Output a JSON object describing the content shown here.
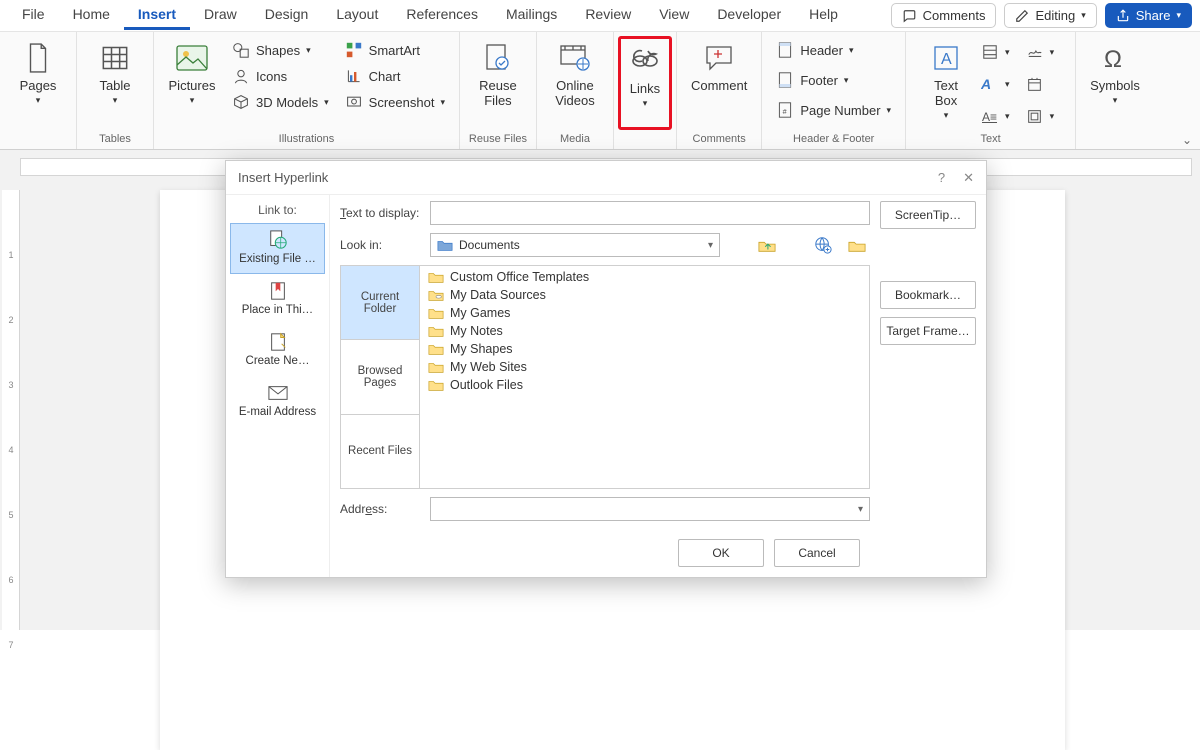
{
  "tabs": [
    "File",
    "Home",
    "Insert",
    "Draw",
    "Design",
    "Layout",
    "References",
    "Mailings",
    "Review",
    "View",
    "Developer",
    "Help"
  ],
  "active_tab_index": 2,
  "top_right": {
    "comments": "Comments",
    "editing": "Editing",
    "share": "Share"
  },
  "groups": {
    "pages": {
      "btn": "Pages",
      "label": ""
    },
    "tables": {
      "btn": "Table",
      "label": "Tables"
    },
    "illustrations": {
      "pictures": "Pictures",
      "small": [
        "Shapes",
        "Icons",
        "3D Models",
        "SmartArt",
        "Chart",
        "Screenshot"
      ],
      "label": "Illustrations"
    },
    "reuse": {
      "btn": "Reuse\nFiles",
      "label": "Reuse Files"
    },
    "media": {
      "btn": "Online\nVideos",
      "label": "Media"
    },
    "links": {
      "btn": "Links"
    },
    "comments": {
      "btn": "Comment",
      "label": "Comments"
    },
    "headerfooter": {
      "items": [
        "Header",
        "Footer",
        "Page Number"
      ],
      "label": "Header & Footer"
    },
    "text": {
      "btn": "Text\nBox",
      "label": "Text"
    },
    "symbols": {
      "btn": "Symbols"
    }
  },
  "dialog": {
    "title": "Insert Hyperlink",
    "linkto_label": "Link to:",
    "linkto": [
      "Existing File …",
      "Place in Thi…",
      "Create Ne…",
      "E-mail Address"
    ],
    "text_to_display": "Text to display:",
    "text_to_display_underline": "T",
    "screentip": "ScreenTip…",
    "lookin_label": "Look in:",
    "lookin_value": "Documents",
    "browse_tabs": [
      "Current Folder",
      "Browsed Pages",
      "Recent Files"
    ],
    "files": [
      "Custom Office Templates",
      "My Data Sources",
      "My Games",
      "My Notes",
      "My Shapes",
      "My Web Sites",
      "Outlook Files"
    ],
    "bookmark": "Bookmark…",
    "target_frame": "Target Frame…",
    "address_label": "Address:",
    "address_underline": "e",
    "ok": "OK",
    "cancel": "Cancel"
  },
  "ruler_ticks": [
    "",
    "",
    "1",
    "",
    "2",
    "",
    "3",
    "",
    "4",
    "",
    "5",
    "",
    "6",
    "",
    "7"
  ]
}
